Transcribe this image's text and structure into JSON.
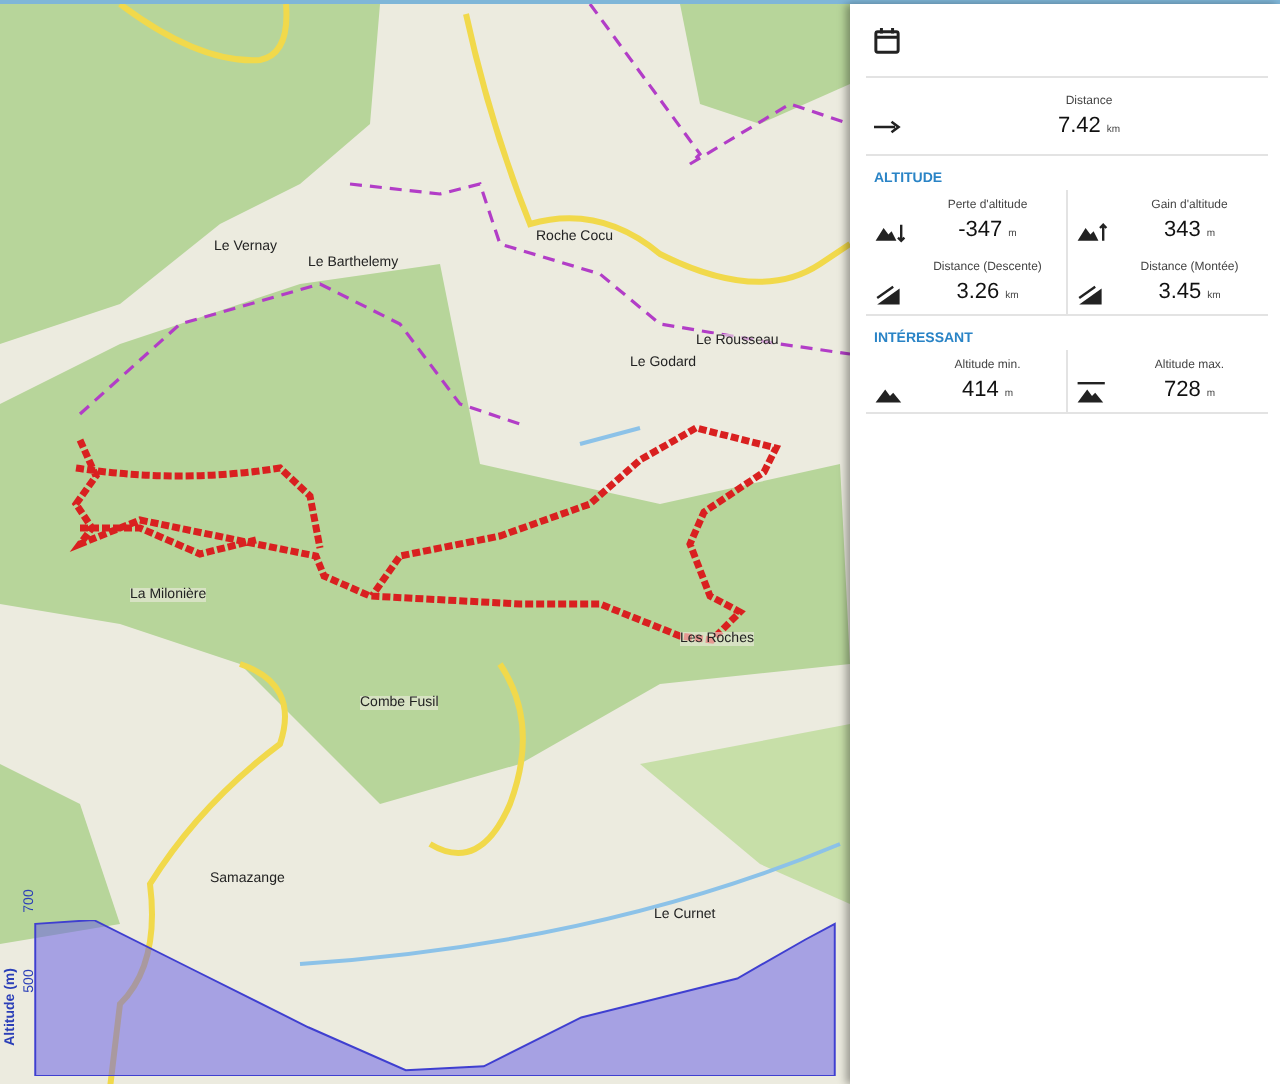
{
  "map": {
    "places": [
      {
        "name": "Le Vernay"
      },
      {
        "name": "Le Barthelemy"
      },
      {
        "name": "Roche Cocu"
      },
      {
        "name": "Le Rousseau"
      },
      {
        "name": "Le Godard"
      },
      {
        "name": "La Milonière"
      },
      {
        "name": "Les Roches"
      },
      {
        "name": "Combe Fusil"
      },
      {
        "name": "Samazange"
      },
      {
        "name": "Le Curnet"
      }
    ],
    "profile": {
      "axis_label": "Altitude (m)",
      "ticks": [
        "700",
        "500"
      ]
    }
  },
  "panel": {
    "distance": {
      "label": "Distance",
      "value": "7.42",
      "unit": "km"
    },
    "sections": [
      {
        "title": "ALTITUDE",
        "stats": [
          {
            "kind": "loss",
            "label": "Perte d'altitude",
            "value": "-347",
            "unit": "m"
          },
          {
            "kind": "gain",
            "label": "Gain d'altitude",
            "value": "343",
            "unit": "m"
          },
          {
            "kind": "descent",
            "label": "Distance (Descente)",
            "value": "3.26",
            "unit": "km"
          },
          {
            "kind": "ascent",
            "label": "Distance (Montée)",
            "value": "3.45",
            "unit": "km"
          }
        ]
      },
      {
        "title": "INTÉRESSANT",
        "stats": [
          {
            "kind": "min",
            "label": "Altitude min.",
            "value": "414",
            "unit": "m"
          },
          {
            "kind": "max",
            "label": "Altitude max.",
            "value": "728",
            "unit": "m"
          }
        ]
      }
    ]
  }
}
